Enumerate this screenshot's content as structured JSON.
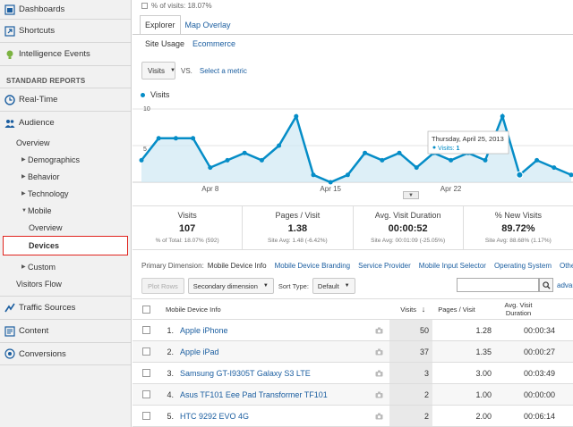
{
  "sidebar": {
    "top_items": [
      {
        "label": "Dashboards",
        "icon": "dashboard-icon"
      },
      {
        "label": "Shortcuts",
        "icon": "shortcut-icon"
      },
      {
        "label": "Intelligence Events",
        "icon": "lightbulb-icon"
      }
    ],
    "standard_reports_title": "STANDARD REPORTS",
    "realtime": {
      "label": "Real-Time",
      "icon": "clock-icon"
    },
    "audience": {
      "label": "Audience",
      "icon": "people-icon"
    },
    "audience_items": {
      "overview": "Overview",
      "demographics": "Demographics",
      "behavior": "Behavior",
      "technology": "Technology",
      "mobile": "Mobile",
      "mobile_overview": "Overview",
      "devices": "Devices",
      "custom": "Custom",
      "visitors_flow": "Visitors Flow"
    },
    "bottom_items": [
      {
        "label": "Traffic Sources",
        "icon": "traffic-icon"
      },
      {
        "label": "Content",
        "icon": "content-icon"
      },
      {
        "label": "Conversions",
        "icon": "conversions-icon"
      }
    ]
  },
  "main": {
    "pct_visits": "% of visits: 18.07%",
    "tabs": {
      "explorer": "Explorer",
      "map_overlay": "Map Overlay"
    },
    "subtabs": {
      "site_usage": "Site Usage",
      "ecommerce": "Ecommerce"
    },
    "metric": {
      "selected": "Visits",
      "vs": "VS.",
      "select_metric": "Select a metric"
    },
    "legend_label": "Visits",
    "chart_data": {
      "type": "area",
      "series_name": "Visits",
      "y_ticks": [
        "10",
        "5"
      ],
      "ylim": [
        0,
        10
      ],
      "x_tick_labels": [
        "Apr 8",
        "Apr 15",
        "Apr 22"
      ],
      "x_tick_index": [
        4,
        11,
        18
      ],
      "values": [
        3,
        6,
        6,
        6,
        2,
        3,
        4,
        3,
        5,
        9,
        1,
        0,
        1,
        4,
        3,
        4,
        2,
        4,
        3,
        4,
        3,
        9,
        1,
        3,
        2,
        1
      ],
      "tooltip": {
        "date": "Thursday, April 25, 2013",
        "metric": "Visits: ",
        "value": "1",
        "index": 22
      },
      "color": "#058dc7"
    },
    "stats": [
      {
        "title": "Visits",
        "value": "107",
        "sub": "% of Total: 18.07% (592)"
      },
      {
        "title": "Pages / Visit",
        "value": "1.38",
        "sub": "Site Avg: 1.48 (-6.42%)"
      },
      {
        "title": "Avg. Visit Duration",
        "value": "00:00:52",
        "sub": "Site Avg: 00:01:09 (-25.05%)"
      },
      {
        "title": "% New Visits",
        "value": "89.72%",
        "sub": "Site Avg: 88.68% (1.17%)"
      }
    ],
    "primary_dimension": {
      "label": "Primary Dimension:",
      "items": [
        "Mobile Device Info",
        "Mobile Device Branding",
        "Service Provider",
        "Mobile Input Selector",
        "Operating System"
      ],
      "other": "Other"
    },
    "toolbar": {
      "plot_rows": "Plot Rows",
      "secondary_dimension": "Secondary dimension",
      "sort_type_label": "Sort Type:",
      "sort_type_value": "Default",
      "search_value": "",
      "advanced": "advanced"
    },
    "table": {
      "headers": {
        "device": "Mobile Device Info",
        "visits": "Visits",
        "pps": "Pages / Visit",
        "duration_line1": "Avg. Visit",
        "duration_line2": "Duration"
      },
      "rows": [
        {
          "idx": "1.",
          "name": "Apple iPhone",
          "visits": "50",
          "pps": "1.28",
          "dur": "00:00:34"
        },
        {
          "idx": "2.",
          "name": "Apple iPad",
          "visits": "37",
          "pps": "1.35",
          "dur": "00:00:27"
        },
        {
          "idx": "3.",
          "name": "Samsung GT-I9305T Galaxy S3 LTE",
          "visits": "3",
          "pps": "3.00",
          "dur": "00:03:49"
        },
        {
          "idx": "4.",
          "name": "Asus TF101 Eee Pad Transformer TF101",
          "visits": "2",
          "pps": "1.00",
          "dur": "00:00:00"
        },
        {
          "idx": "5.",
          "name": "HTC 9292 EVO 4G",
          "visits": "2",
          "pps": "2.00",
          "dur": "00:06:14"
        }
      ]
    }
  }
}
